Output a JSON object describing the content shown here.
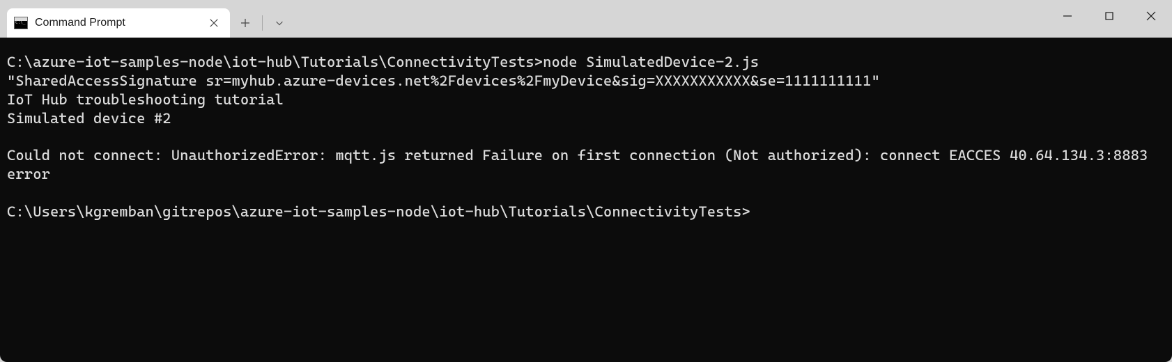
{
  "tab": {
    "title": "Command Prompt"
  },
  "terminal": {
    "lines": [
      "C:\\azure-iot-samples-node\\iot-hub\\Tutorials\\ConnectivityTests>node SimulatedDevice-2.js",
      "\"SharedAccessSignature sr=myhub.azure-devices.net%2Fdevices%2FmyDevice&sig=XXXXXXXXXXX&se=1111111111\"",
      "IoT Hub troubleshooting tutorial",
      "Simulated device #2",
      "",
      "Could not connect: UnauthorizedError: mqtt.js returned Failure on first connection (Not authorized): connect EACCES 40.64.134.3:8883 error",
      "",
      "C:\\Users\\kgremban\\gitrepos\\azure-iot-samples-node\\iot-hub\\Tutorials\\ConnectivityTests>"
    ]
  },
  "colors": {
    "titlebar": "#d6d6d6",
    "tab_bg": "#ffffff",
    "terminal_bg": "#0c0c0c",
    "terminal_fg": "#dcdcdc"
  }
}
